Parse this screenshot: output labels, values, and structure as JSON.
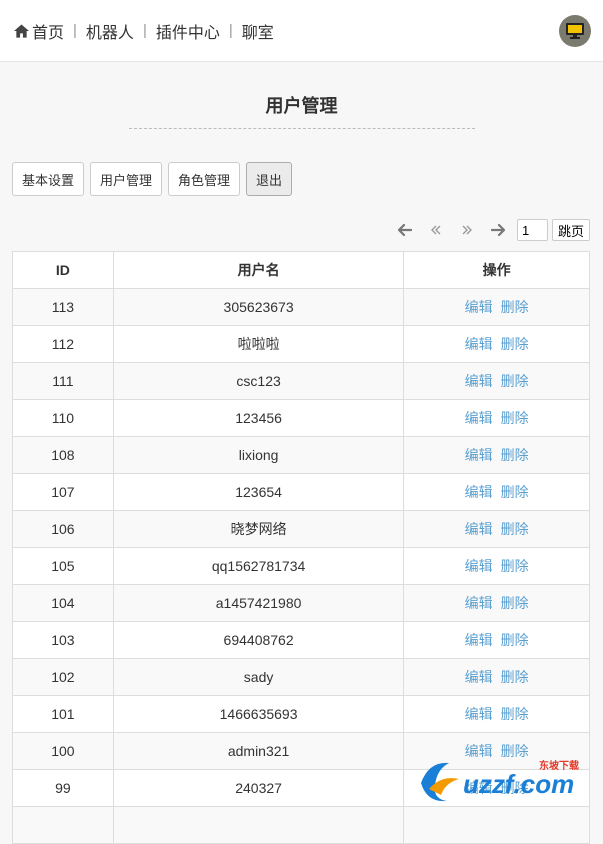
{
  "nav": {
    "items": [
      {
        "label": "首页"
      },
      {
        "label": "机器人"
      },
      {
        "label": "插件中心"
      },
      {
        "label": "聊室"
      }
    ],
    "separator": "|"
  },
  "page": {
    "title": "用户管理"
  },
  "toolbar": {
    "basic_settings": "基本设置",
    "user_management": "用户管理",
    "role_management": "角色管理",
    "logout": "退出"
  },
  "pager": {
    "prev_icon": "arrow-left-icon",
    "first_icon": "double-left-icon",
    "last_icon": "double-right-icon",
    "next_icon": "arrow-right-icon",
    "page_value": "1",
    "jump_label": "跳页"
  },
  "table": {
    "headers": {
      "id": "ID",
      "username": "用户名",
      "actions": "操作"
    },
    "edit_label": "编辑",
    "delete_label": "删除",
    "rows": [
      {
        "id": "113",
        "username": "305623673"
      },
      {
        "id": "112",
        "username": "啦啦啦"
      },
      {
        "id": "111",
        "username": "csc123"
      },
      {
        "id": "110",
        "username": "123456"
      },
      {
        "id": "108",
        "username": "lixiong"
      },
      {
        "id": "107",
        "username": "123654"
      },
      {
        "id": "106",
        "username": "晓梦网络"
      },
      {
        "id": "105",
        "username": "qq1562781734"
      },
      {
        "id": "104",
        "username": "a1457421980"
      },
      {
        "id": "103",
        "username": "694408762"
      },
      {
        "id": "102",
        "username": "sady"
      },
      {
        "id": "101",
        "username": "1466635693"
      },
      {
        "id": "100",
        "username": "admin321"
      },
      {
        "id": "99",
        "username": "240327"
      },
      {
        "id": "",
        "username": ""
      }
    ]
  },
  "watermark": {
    "text": "uzzf.com",
    "sub": "东坡下载"
  },
  "colors": {
    "link": "#5a9fd0",
    "monitor_bg": "#7a7a6e",
    "monitor_screen": "#f2c200"
  }
}
